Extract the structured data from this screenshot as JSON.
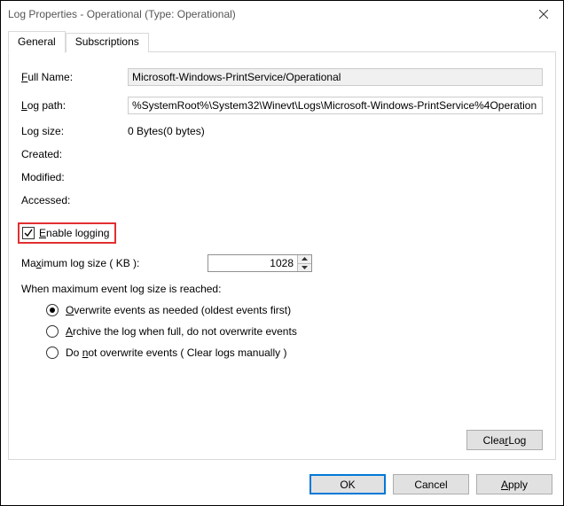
{
  "window": {
    "title": "Log Properties - Operational (Type: Operational)"
  },
  "tabs": {
    "general": "General",
    "subscriptions": "Subscriptions"
  },
  "labels": {
    "full_name": "ull Name:",
    "full_name_mn": "F",
    "log_path": "og path:",
    "log_path_mn": "L",
    "log_size": "Log size:",
    "created": "Created:",
    "modified": "Modified:",
    "accessed": "Accessed:",
    "enable_logging": "nable logging",
    "enable_logging_mn": "E",
    "max_pre": "Ma",
    "max_mn": "x",
    "max_post": "imum log size ( KB ):",
    "reached": "When maximum event log size is reached:",
    "r1_pre": "",
    "r1_mn": "O",
    "r1_post": "verwrite events as needed (oldest events first)",
    "r2_pre": "",
    "r2_mn": "A",
    "r2_post": "rchive the log when full, do not overwrite events",
    "r3_pre": "Do ",
    "r3_mn": "n",
    "r3_post": "ot overwrite events ( Clear logs manually )"
  },
  "values": {
    "full_name": "Microsoft-Windows-PrintService/Operational",
    "log_path": "%SystemRoot%\\System32\\Winevt\\Logs\\Microsoft-Windows-PrintService%4Operation",
    "log_size": "0 Bytes(0 bytes)",
    "created": "",
    "modified": "",
    "accessed": "",
    "enable_logging_checked": true,
    "max_size": "1028",
    "selected_radio": 0
  },
  "buttons": {
    "clear_log_pre": "Clea",
    "clear_log_mn": "r",
    "clear_log_post": " Log",
    "ok": "OK",
    "cancel": "Cancel",
    "apply_pre": "",
    "apply_mn": "A",
    "apply_post": "pply"
  }
}
